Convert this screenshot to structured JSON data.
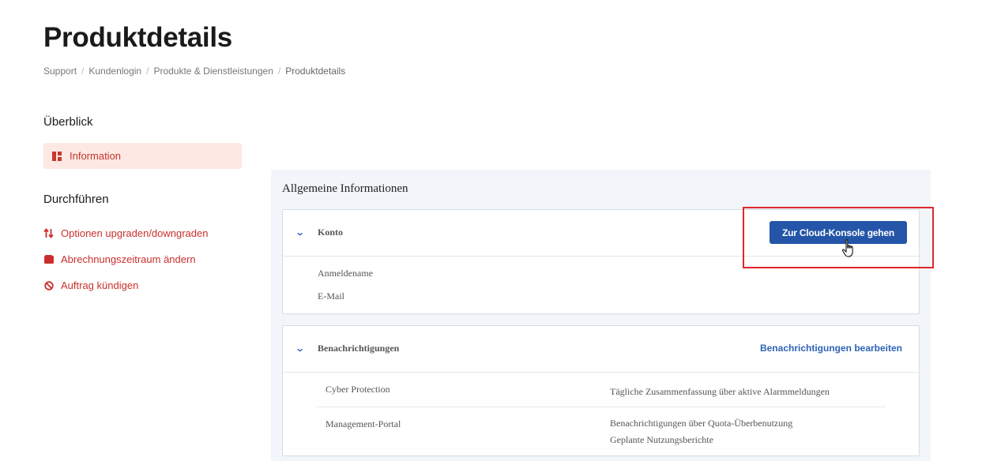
{
  "page": {
    "title": "Produktdetails",
    "breadcrumb": [
      "Support",
      "Kundenlogin",
      "Produkte & Dienstleistungen",
      "Produktdetails"
    ]
  },
  "sidebar": {
    "overview_heading": "Überblick",
    "overview_items": [
      {
        "label": "Information",
        "icon": "dashboard-icon"
      }
    ],
    "actions_heading": "Durchführen",
    "actions": [
      {
        "label": "Optionen upgraden/downgraden",
        "icon": "arrows-updown-icon"
      },
      {
        "label": "Abrechnungszeitraum ändern",
        "icon": "wallet-icon"
      },
      {
        "label": "Auftrag kündigen",
        "icon": "ban-icon"
      }
    ]
  },
  "main": {
    "panel_title": "Allgemeine Informationen",
    "konto": {
      "label": "Konto",
      "cta": "Zur Cloud-Konsole gehen",
      "fields": [
        "Anmeldename",
        "E-Mail"
      ]
    },
    "notifications": {
      "label": "Benachrichtigungen",
      "edit_link": "Benachrichtigungen bearbeiten",
      "rows": [
        {
          "name": "Cyber Protection",
          "values": [
            "Tägliche Zusammenfassung über aktive Alarmmeldungen"
          ]
        },
        {
          "name": "Management-Portal",
          "values": [
            "Benachrichtigungen über Quota-Überbenutzung",
            "Geplante Nutzungsberichte"
          ]
        }
      ]
    }
  },
  "colors": {
    "accent": "#2555a8",
    "danger": "#c9302c",
    "active_bg": "#fde8e4",
    "panel_bg": "#f2f5f9",
    "highlight": "#e0262a"
  }
}
